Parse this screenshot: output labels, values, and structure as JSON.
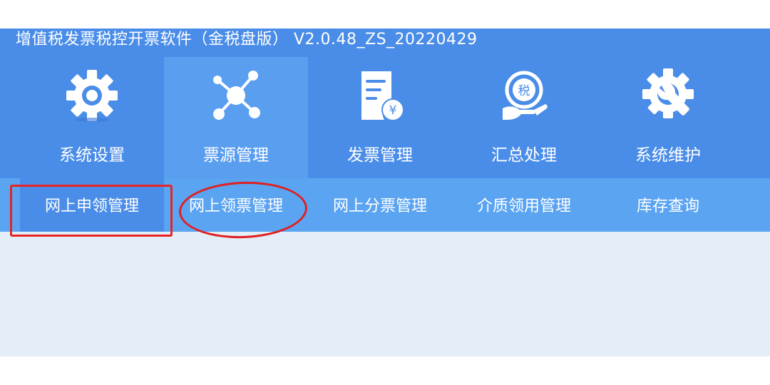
{
  "title": "增值税发票税控开票软件（金税盘版） V2.0.48_ZS_20220429",
  "toolbar": {
    "items": [
      {
        "label": "系统设置",
        "icon": "gear-icon"
      },
      {
        "label": "票源管理",
        "icon": "network-nodes-icon"
      },
      {
        "label": "发票管理",
        "icon": "invoice-yuan-icon"
      },
      {
        "label": "汇总处理",
        "icon": "tax-seal-icon"
      },
      {
        "label": "系统维护",
        "icon": "wrench-gear-icon"
      }
    ],
    "active_index": 1
  },
  "subnav": {
    "items": [
      {
        "label": "网上申领管理"
      },
      {
        "label": "网上领票管理"
      },
      {
        "label": "网上分票管理"
      },
      {
        "label": "介质领用管理"
      },
      {
        "label": "库存查询"
      }
    ],
    "active_index": 0
  },
  "colors": {
    "header_bg": "#4a8de8",
    "active_tool_bg": "#5a9ef0",
    "subnav_bg": "#5aa4f2",
    "content_bg": "#e4eef8",
    "annotation_red": "#e82424"
  }
}
